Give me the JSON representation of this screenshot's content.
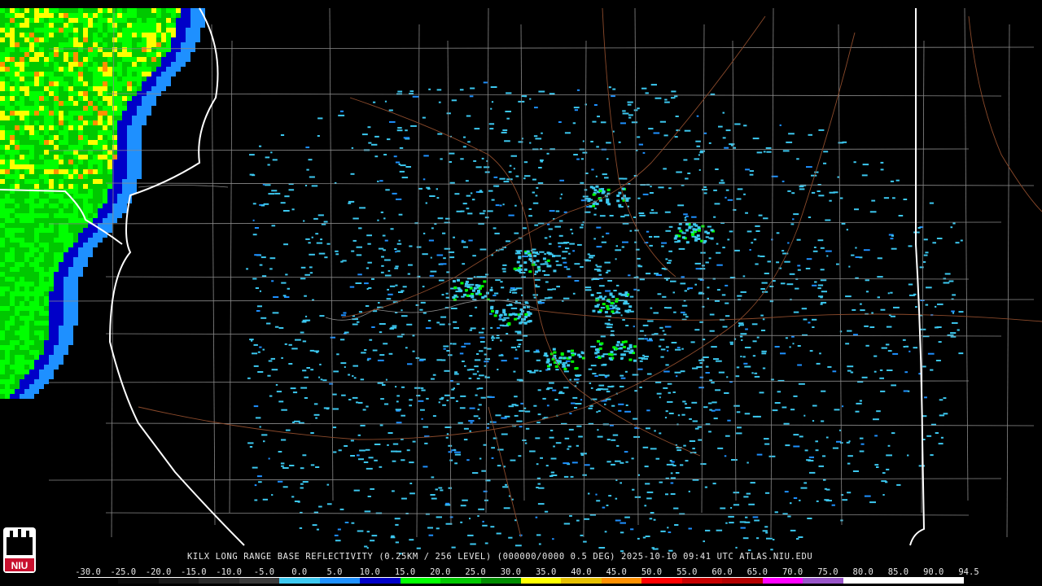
{
  "map": {
    "caption": "KILX LONG RANGE BASE REFLECTIVITY (0.25KM / 256 LEVEL) (000000/0000 0.5 DEG) 2025-10-10 09:41 UTC  ATLAS.NIU.EDU",
    "colors": {
      "background": "#000000",
      "county_lines": "#8a8a8a",
      "state_lines": "#ffffff",
      "roads": "#8b4a2b"
    }
  },
  "scale": {
    "labels": [
      "-30.0",
      "-25.0",
      "-20.0",
      "-15.0",
      "-10.0",
      "-5.0",
      "0.0",
      "5.0",
      "10.0",
      "15.0",
      "20.0",
      "25.0",
      "30.0",
      "35.0",
      "40.0",
      "45.0",
      "50.0",
      "55.0",
      "60.0",
      "65.0",
      "70.0",
      "75.0",
      "80.0",
      "85.0",
      "90.0",
      "94.5"
    ],
    "colors": [
      "#000000",
      "#0a0a0a",
      "#1a1a1a",
      "#2a2a2a",
      "#3a3a3a",
      "#3cc8f0",
      "#1e90ff",
      "#0000c8",
      "#00ff00",
      "#00c800",
      "#008c00",
      "#ffff00",
      "#e6c000",
      "#ff9000",
      "#ff0000",
      "#c80000",
      "#b40000",
      "#ff00ff",
      "#9955c9",
      "#ffffff",
      "#ffffff",
      "#ffffff"
    ]
  },
  "logo": {
    "text": "NIU"
  }
}
